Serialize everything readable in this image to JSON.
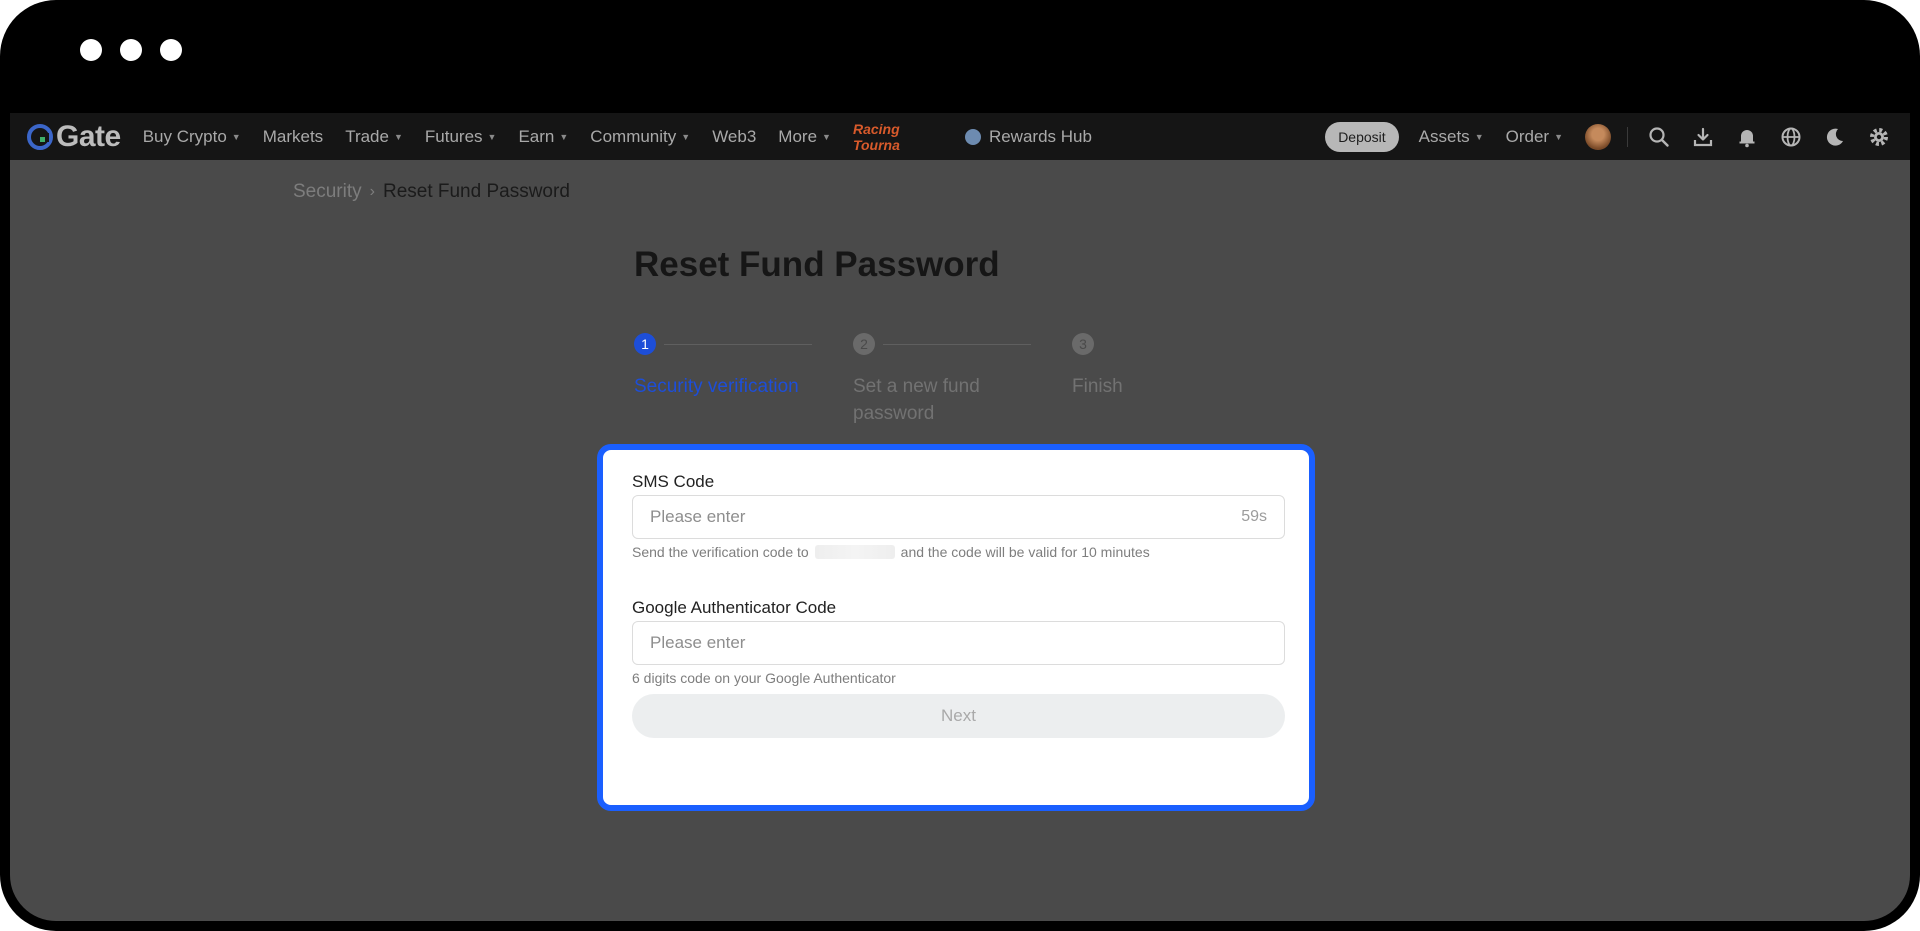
{
  "nav": {
    "logo_text": "Gate",
    "items": [
      {
        "label": "Buy Crypto",
        "dropdown": true
      },
      {
        "label": "Markets",
        "dropdown": false
      },
      {
        "label": "Trade",
        "dropdown": true
      },
      {
        "label": "Futures",
        "dropdown": true
      },
      {
        "label": "Earn",
        "dropdown": true
      },
      {
        "label": "Community",
        "dropdown": true
      },
      {
        "label": "Web3",
        "dropdown": false
      },
      {
        "label": "More",
        "dropdown": true
      }
    ],
    "promo_text": "Racing Tourna",
    "rewards_label": "Rewards Hub",
    "deposit_label": "Deposit",
    "assets_label": "Assets",
    "order_label": "Order",
    "icons": [
      "search-icon",
      "download-icon",
      "bell-icon",
      "globe-icon",
      "moon-icon",
      "gear-icon"
    ]
  },
  "breadcrumb": {
    "parent": "Security",
    "separator": "›",
    "current": "Reset Fund Password"
  },
  "page_title": "Reset Fund Password",
  "steps": [
    {
      "number": "1",
      "label": "Security verification",
      "state": "active"
    },
    {
      "number": "2",
      "label": "Set a new fund password",
      "state": "inactive"
    },
    {
      "number": "3",
      "label": "Finish",
      "state": "inactive"
    }
  ],
  "form": {
    "sms": {
      "label": "SMS Code",
      "placeholder": "Please enter",
      "value": "",
      "timer": "59s",
      "hint_before": "Send the verification code to",
      "hint_after": "and the code will be valid for 10 minutes"
    },
    "google": {
      "label": "Google Authenticator Code",
      "placeholder": "Please enter",
      "value": "",
      "hint": "6 digits code on your Google Authenticator"
    },
    "next_label": "Next"
  },
  "colors": {
    "accent": "#1a5fff",
    "step_active": "#1d4ed8",
    "nav_bg": "#151515",
    "overlay_bg": "#4a4a4a"
  }
}
